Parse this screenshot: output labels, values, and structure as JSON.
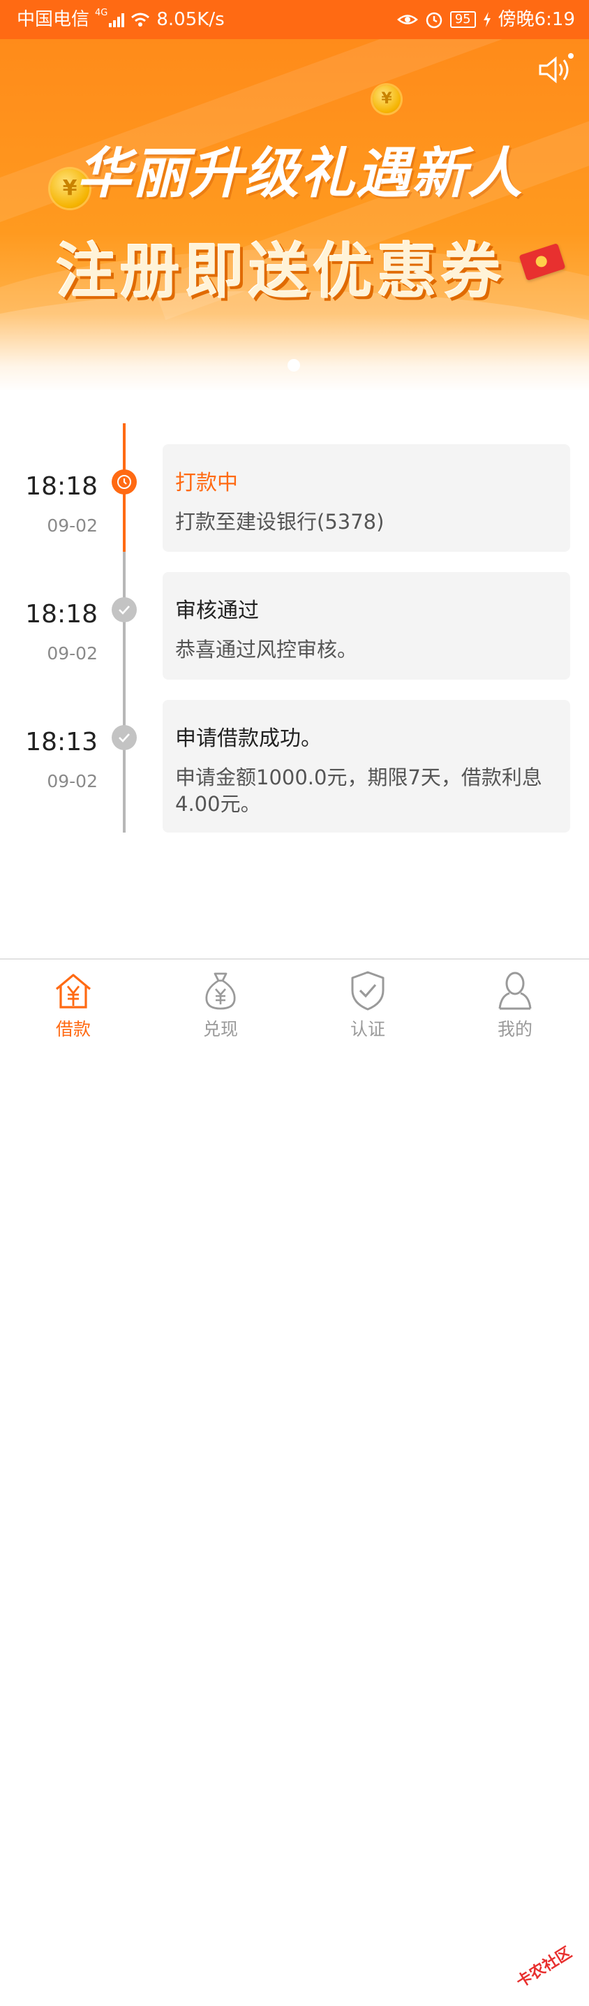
{
  "status_bar": {
    "carrier": "中国电信",
    "network": "4G",
    "speed": "8.05K/s",
    "battery": "95",
    "time": "傍晚6:19"
  },
  "banner": {
    "headline_top": "华丽升级礼遇新人",
    "headline_main": "注册即送优惠券",
    "coin_symbol": "¥"
  },
  "timeline": [
    {
      "time": "18:18",
      "date": "09-02",
      "title": "打款中",
      "desc": "打款至建设银行(5378)",
      "state": "active"
    },
    {
      "time": "18:18",
      "date": "09-02",
      "title": "审核通过",
      "desc": "恭喜通过风控审核。",
      "state": "done"
    },
    {
      "time": "18:13",
      "date": "09-02",
      "title": "申请借款成功。",
      "desc": "申请金额1000.0元，期限7天，借款利息4.00元。",
      "state": "done"
    }
  ],
  "nav": {
    "items": [
      {
        "label": "借款",
        "icon": "house-yen-icon",
        "active": true
      },
      {
        "label": "兑现",
        "icon": "money-bag-icon",
        "active": false
      },
      {
        "label": "认证",
        "icon": "shield-check-icon",
        "active": false
      },
      {
        "label": "我的",
        "icon": "user-icon",
        "active": false
      }
    ]
  },
  "watermark": "卡农社区",
  "colors": {
    "accent": "#ff6a13",
    "inactive": "#9a9a9a",
    "card_bg": "#f4f4f4"
  }
}
